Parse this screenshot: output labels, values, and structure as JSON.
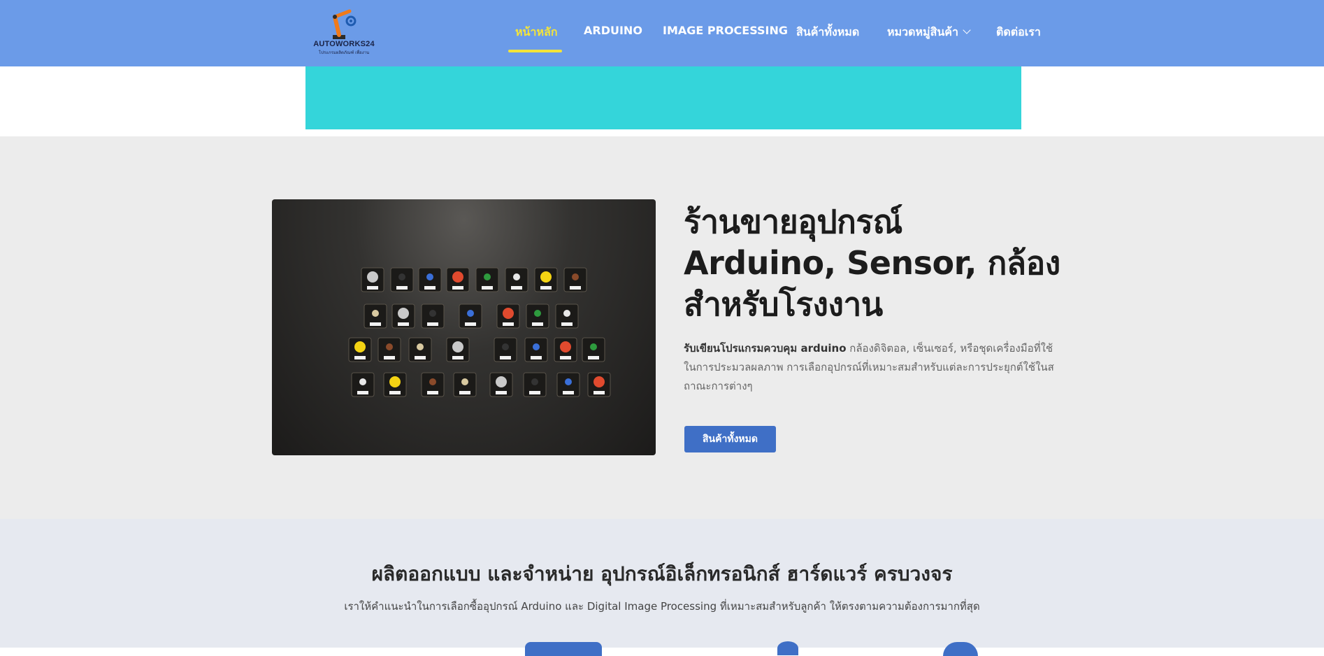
{
  "header": {
    "logo": {
      "name": "AUTOWORKS24",
      "tagline": "โปรแกรมผลิตภัณฑ์ เพื่องาน"
    },
    "nav": [
      {
        "label": "หน้าหลัก",
        "active": true
      },
      {
        "label": "ARDUINO"
      },
      {
        "label": "IMAGE PROCESSING"
      },
      {
        "label": "สินค้าทั้งหมด"
      },
      {
        "label": "หมวดหมู่สินค้า",
        "dropdown": true
      },
      {
        "label": "ติดต่อเรา"
      }
    ]
  },
  "hero": {
    "title_line1": "ร้านขายอุปกรณ์",
    "title_line2": "Arduino, Sensor, กล้อง",
    "title_line3": "สำหรับโรงงาน",
    "desc_bold": "รับเขียนโปรแกรมควบคุม arduino",
    "desc_rest": " กล้องดิจิตอล, เซ็นเซอร์, หรือชุดเครื่องมือที่ใช้ในการประมวลผลภาพ การเลือกอุปกรณ์ที่เหมาะสมสำหรับแต่ละการประยุกต์ใช้ในสถาณะการต่างๆ",
    "button": "สินค้าทั้งหมด"
  },
  "section2": {
    "title": "ผลิตออกแบบ และจำหน่าย อุปกรณ์อิเล็กทรอนิกส์ ฮาร์ดแวร์ ครบวงจร",
    "subtitle": "เราให้คำแนะนำในการเลือกซื้ออุปกรณ์ Arduino และ Digital Image Processing ที่เหมาะสมสำหรับลูกค้า ให้ตรงตามความต้องการมากที่สุด"
  },
  "colors": {
    "header_bg": "#6b9be8",
    "active_nav": "#f3e43a",
    "banner": "#34d5da",
    "button": "#3f6fc6",
    "hero_bg": "#ececec",
    "section2_bg": "#e6e9f0"
  }
}
